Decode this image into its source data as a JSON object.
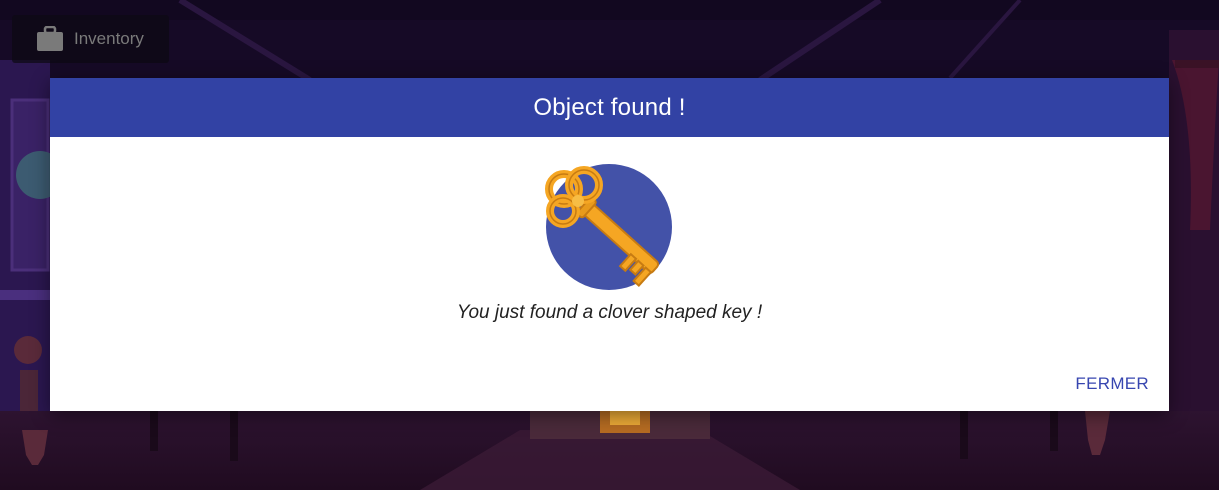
{
  "inventory": {
    "label": "Inventory",
    "icon": "briefcase-icon"
  },
  "modal": {
    "title": "Object found !",
    "message": "You just found a clover shaped key !",
    "close_label": "FERMER",
    "object_icon": "clover-key-icon",
    "header_color": "#3242a4",
    "circle_color": "#4352a8",
    "key_color": "#f5a623"
  }
}
